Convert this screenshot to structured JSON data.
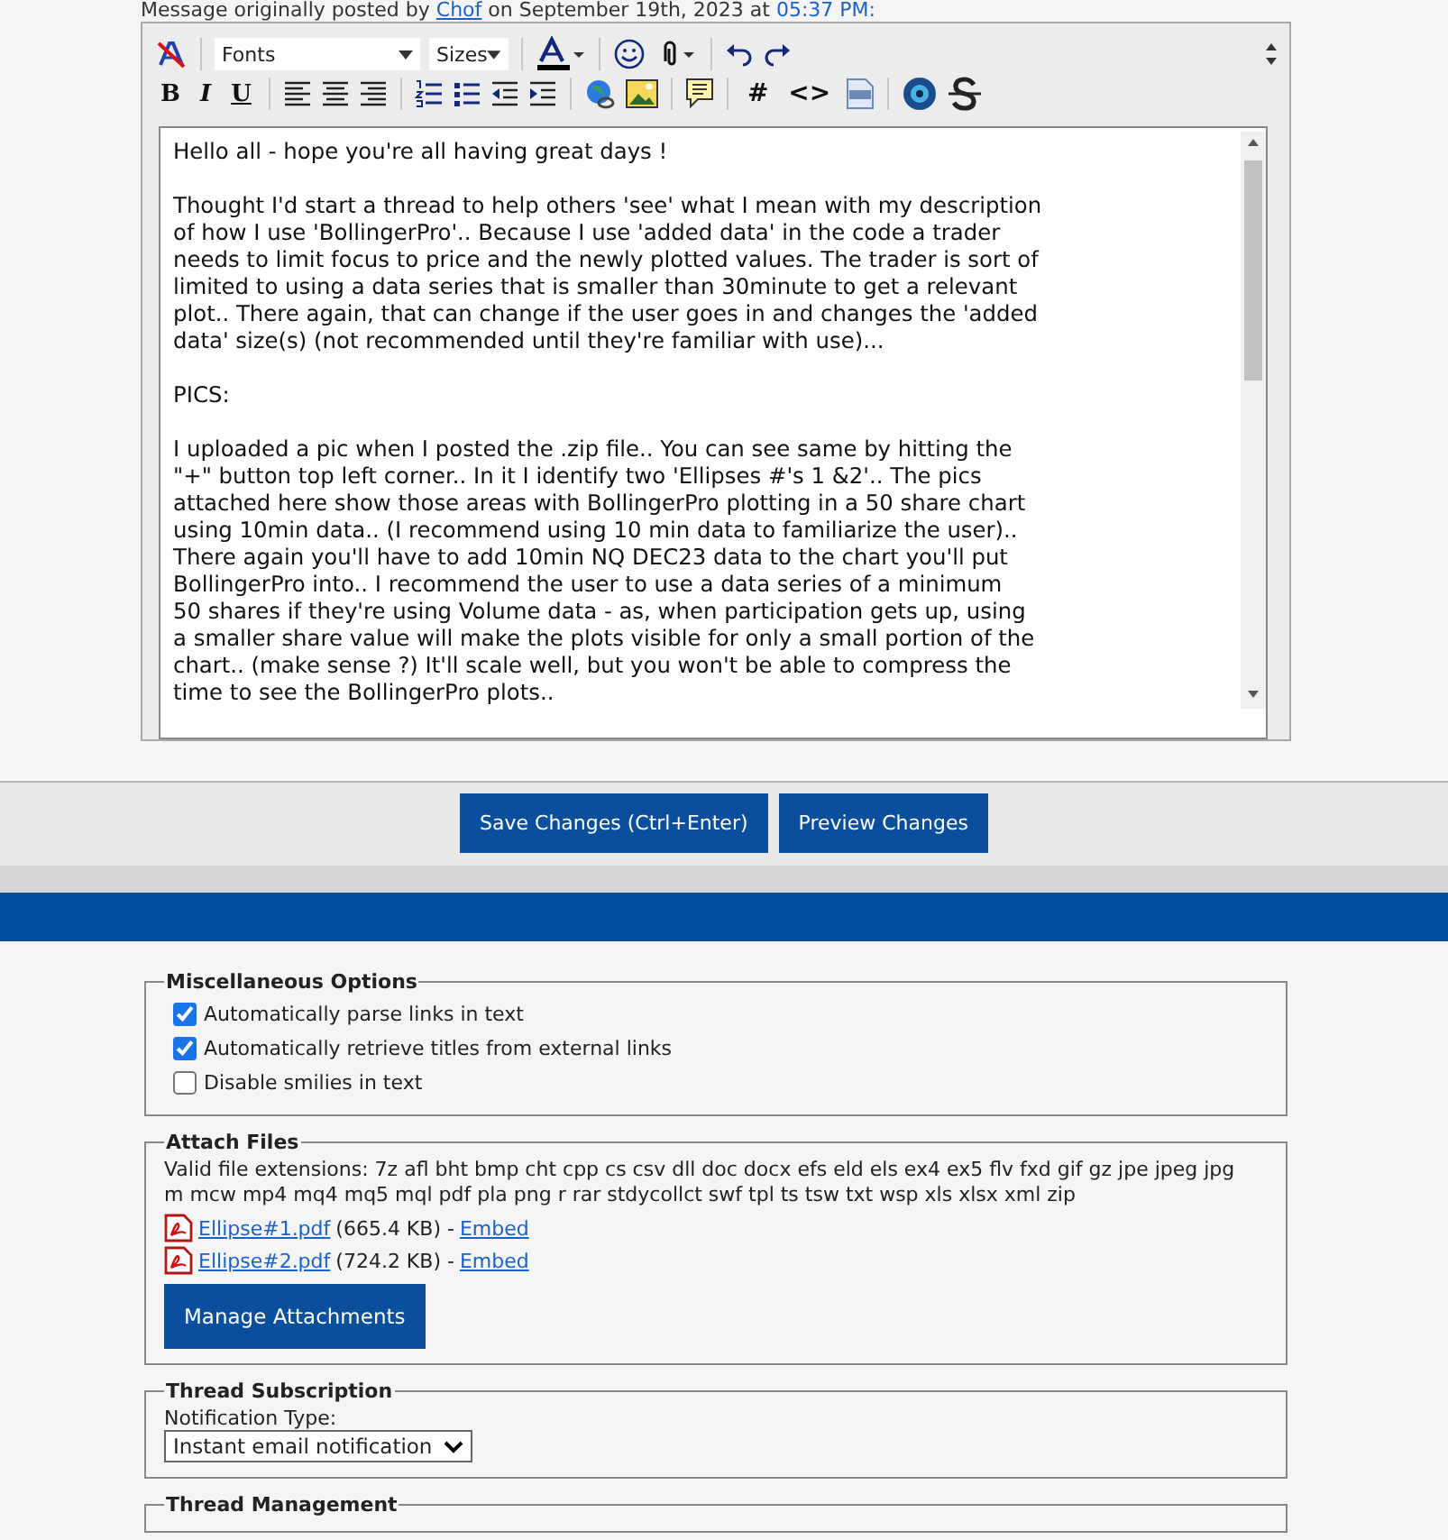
{
  "post_info": {
    "prefix": "Message originally posted by",
    "author": "Chof",
    "middle": "on September 19th, 2023 at",
    "time": "05:37 PM:"
  },
  "editor": {
    "font_select": "Fonts",
    "size_select": "Sizes",
    "format_buttons": [
      "B",
      "I",
      "U"
    ],
    "code_buttons": [
      "#",
      "<>"
    ],
    "paragraphs": [
      "Hello all - hope you're all having great days !",
      "Thought I'd start a thread to help others 'see' what I mean with my description\nof how I use 'BollingerPro'.. Because I use 'added data' in the code a trader\nneeds to limit focus to price and the newly plotted values.  The trader is sort of\nlimited to using a data series that is smaller than 30minute to get a relevant\nplot.. There again, that can change if the user goes in and changes the 'added\ndata' size(s) (not recommended until they're familiar with use)...",
      "PICS:",
      "I uploaded a pic when I posted the .zip file.. You can see same by hitting the\n\"+\" button top left corner.. In it I identify two 'Ellipses #'s 1 &2'.. The pics\nattached here show those areas with BollingerPro plotting in a 50 share chart\nusing 10min data.. (I recommend using 10 min data to familiarize the user)..\nThere again you'll have to add 10min NQ DEC23 data to the chart you'll put\nBollingerPro into.. I recommend the user to use a data series of a minimum\n50 shares if they're using Volume data - as, when participation gets up, using\na smaller share value will make the plots visible for only a small portion of the\nchart.. (make sense ?) It'll scale well, but you won't be able to compress the\ntime to see the BollingerPro plots.."
    ]
  },
  "buttons": [
    "Save Changes (Ctrl+Enter)",
    "Preview Changes"
  ],
  "misc_options": {
    "legend": "Miscellaneous Options",
    "options": [
      {
        "label": "Automatically parse links in text",
        "checked": true
      },
      {
        "label": "Automatically retrieve titles from external links",
        "checked": true
      },
      {
        "label": "Disable smilies in text",
        "checked": false
      }
    ]
  },
  "attach_files": {
    "legend": "Attach Files",
    "extensions": "Valid file extensions: 7z afl bht bmp cht cpp cs csv dll doc docx efs eld els ex4 ex5 flv fxd gif gz jpe jpeg jpg\nm mcw mp4 mq4 mq5 mql pdf pla png r rar stdycollct swf tpl ts tsw txt wsp xls xlsx xml zip",
    "files": [
      {
        "name": "Ellipse#1.pdf",
        "size": "(665.4 KB) -",
        "action": "Embed"
      },
      {
        "name": "Ellipse#2.pdf",
        "size": "(724.2 KB) -",
        "action": "Embed"
      }
    ],
    "button": "Manage Attachments"
  },
  "thread_subscription": {
    "legend": "Thread Subscription",
    "label": "Notification Type:",
    "value": "Instant email notification"
  },
  "thread_management": {
    "legend": "Thread Management"
  }
}
